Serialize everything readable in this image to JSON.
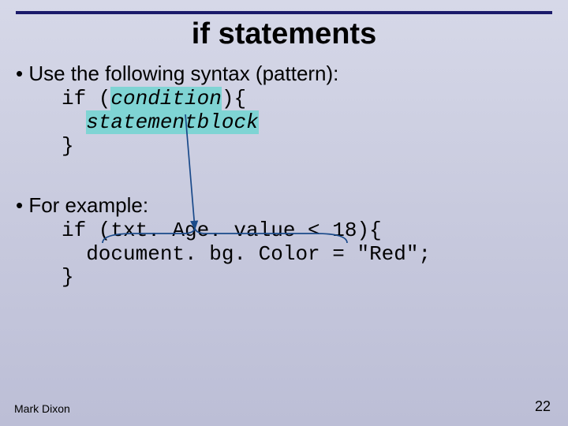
{
  "title": "if statements",
  "bullet1": "• Use the following syntax (pattern):",
  "pattern": {
    "line1a": "if (",
    "line1b": "condition",
    "line1c": "){",
    "line2": "statementblock",
    "line3": "}"
  },
  "bullet2": "• For example:",
  "example": {
    "line1": "if (txt. Age. value < 18){",
    "line2": "  document. bg. Color = \"Red\";",
    "line3": "}"
  },
  "footer": {
    "author": "Mark Dixon",
    "page": "22"
  }
}
